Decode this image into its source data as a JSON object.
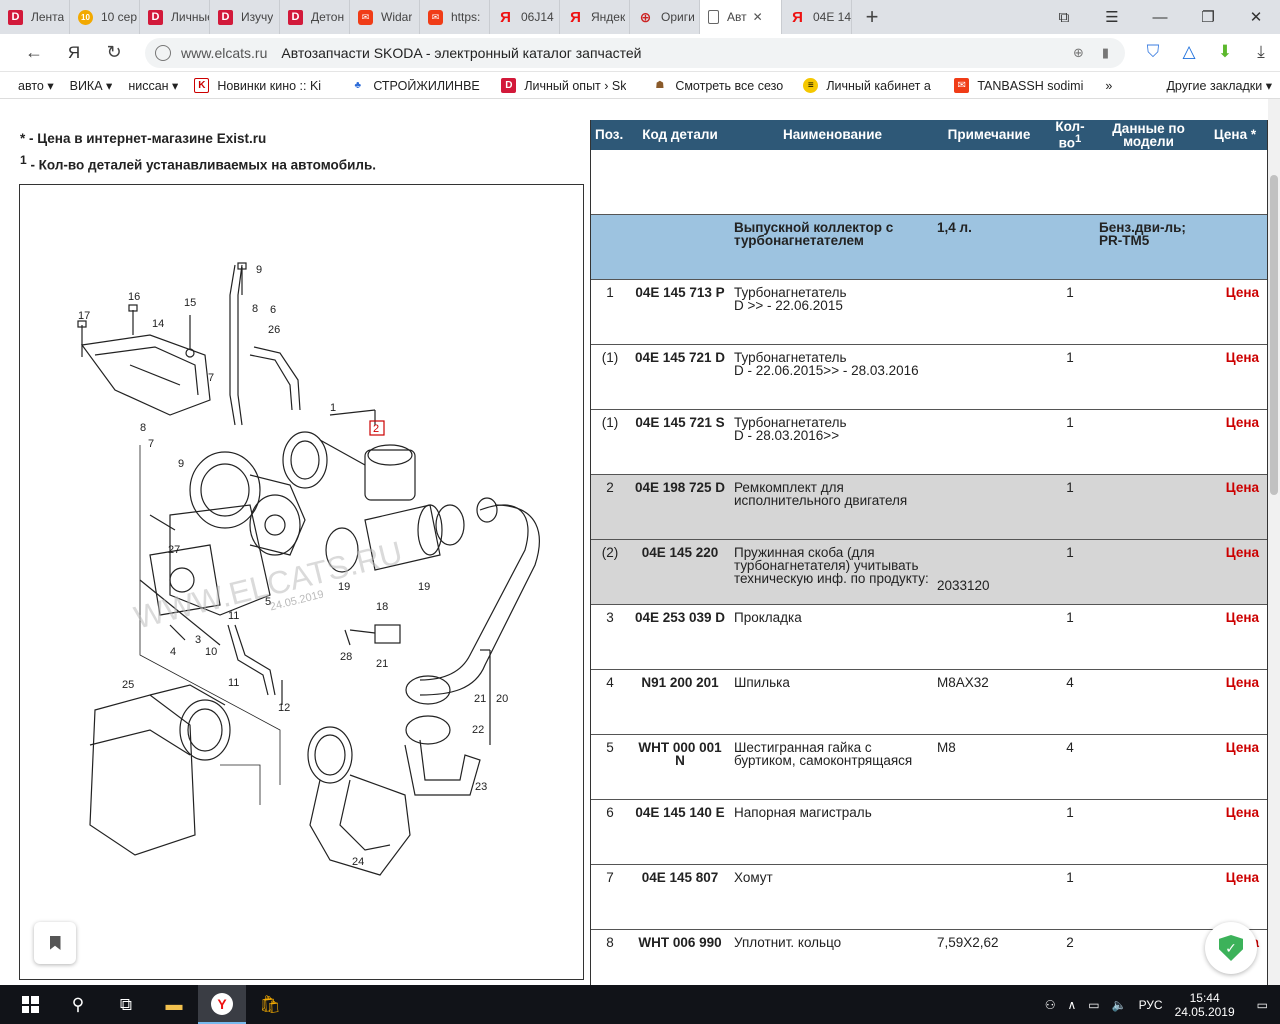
{
  "browser": {
    "tabs": [
      {
        "title": "Лента",
        "icon": "d"
      },
      {
        "title": "10 сер",
        "icon": "ring"
      },
      {
        "title": "Личные",
        "icon": "d"
      },
      {
        "title": "Изучу",
        "icon": "d"
      },
      {
        "title": "Детон",
        "icon": "d"
      },
      {
        "title": "Widar",
        "icon": "mail"
      },
      {
        "title": "https:",
        "icon": "mail"
      },
      {
        "title": "06J14",
        "icon": "ya"
      },
      {
        "title": "Яндек",
        "icon": "ya"
      },
      {
        "title": "Ориги",
        "icon": "orig"
      },
      {
        "title": "Авт",
        "icon": "doc",
        "active": true
      },
      {
        "title": "04E 14",
        "icon": "ya"
      }
    ],
    "url": "www.elcats.ru",
    "page_title": "Автозапчасти SKODA - электронный каталог запчастей",
    "bookmarks": [
      {
        "label": "авто ▾"
      },
      {
        "label": "ВИКА ▾"
      },
      {
        "label": "ниссан ▾"
      },
      {
        "label": "Новинки кино :: Ki"
      },
      {
        "label": "СТРОЙЖИЛИНВЕ"
      },
      {
        "label": "Личный опыт › Sk"
      },
      {
        "label": "Смотреть все сезо"
      },
      {
        "label": "Личный кабинет а"
      },
      {
        "label": "TANBASSH sodimi"
      }
    ],
    "bookmarks_more": "»",
    "other_bookmarks": "Другие закладки ▾"
  },
  "page": {
    "note_price": "* - Цена в интернет-магазине Exist.ru",
    "note_qty_sup": "1",
    "note_qty": " - Кол-во деталей устанавливаемых на автомобиль.",
    "watermark": "WWW.ELCATS.RU",
    "watermark_date": "24.05.2019"
  },
  "table": {
    "headers": {
      "pos": "Поз.",
      "code": "Код детали",
      "name": "Наименование",
      "note": "Примечание",
      "qty": "Кол-во",
      "qty_sup": "1",
      "model": "Данные по модели",
      "price": "Цена *"
    },
    "group": {
      "name": "Выпускной коллектор с турбонагнетателем",
      "note": "1,4 л.",
      "model": "Бенз.дви-ль; PR-TM5"
    },
    "rows": [
      {
        "pos": "1",
        "code": "04E 145 713 P",
        "name": "Турбонагнетатель",
        "name2": "D >> - 22.06.2015",
        "note": "",
        "qty": "1",
        "price": "Цена",
        "grey": false
      },
      {
        "pos": "(1)",
        "code": "04E 145 721 D",
        "name": "Турбонагнетатель",
        "name2": "D - 22.06.2015>> - 28.03.2016",
        "note": "",
        "qty": "1",
        "price": "Цена",
        "grey": false
      },
      {
        "pos": "(1)",
        "code": "04E 145 721 S",
        "name": "Турбонагнетатель",
        "name2": "D - 28.03.2016>>",
        "note": "",
        "qty": "1",
        "price": "Цена",
        "grey": false
      },
      {
        "pos": "2",
        "code": "04E 198 725 D",
        "name": "Ремкомплект для исполнительного двигателя",
        "name2": "",
        "note": "",
        "qty": "1",
        "price": "Цена",
        "grey": true
      },
      {
        "pos": "(2)",
        "code": "04E 145 220",
        "name": "Пружинная скоба (для турбонагнетателя) учитывать техническую инф. по продукту:",
        "name2": "",
        "note": "2033120",
        "qty": "1",
        "price": "Цена",
        "grey": true
      },
      {
        "pos": "3",
        "code": "04E 253 039 D",
        "name": "Прокладка",
        "name2": "",
        "note": "",
        "qty": "1",
        "price": "Цена",
        "grey": false
      },
      {
        "pos": "4",
        "code": "N91 200 201",
        "name": "Шпилька",
        "name2": "",
        "note": "M8AX32",
        "qty": "4",
        "price": "Цена",
        "grey": false
      },
      {
        "pos": "5",
        "code": "WHT 000 001 N",
        "name": "Шестигранная гайка с буртиком, самоконтрящаяся",
        "name2": "",
        "note": "M8",
        "qty": "4",
        "price": "Цена",
        "grey": false
      },
      {
        "pos": "6",
        "code": "04E 145 140 E",
        "name": "Напорная магистраль",
        "name2": "",
        "note": "",
        "qty": "1",
        "price": "Цена",
        "grey": false
      },
      {
        "pos": "7",
        "code": "04E 145 807",
        "name": "Хомут",
        "name2": "",
        "note": "",
        "qty": "1",
        "price": "Цена",
        "grey": false
      },
      {
        "pos": "8",
        "code": "WHT 006 990",
        "name": "Уплотнит. кольцо",
        "name2": "",
        "note": "7,59X2,62",
        "qty": "2",
        "price": "Цена",
        "grey": false
      }
    ]
  },
  "taskbar": {
    "lang": "РУС",
    "time": "15:44",
    "date": "24.05.2019"
  }
}
